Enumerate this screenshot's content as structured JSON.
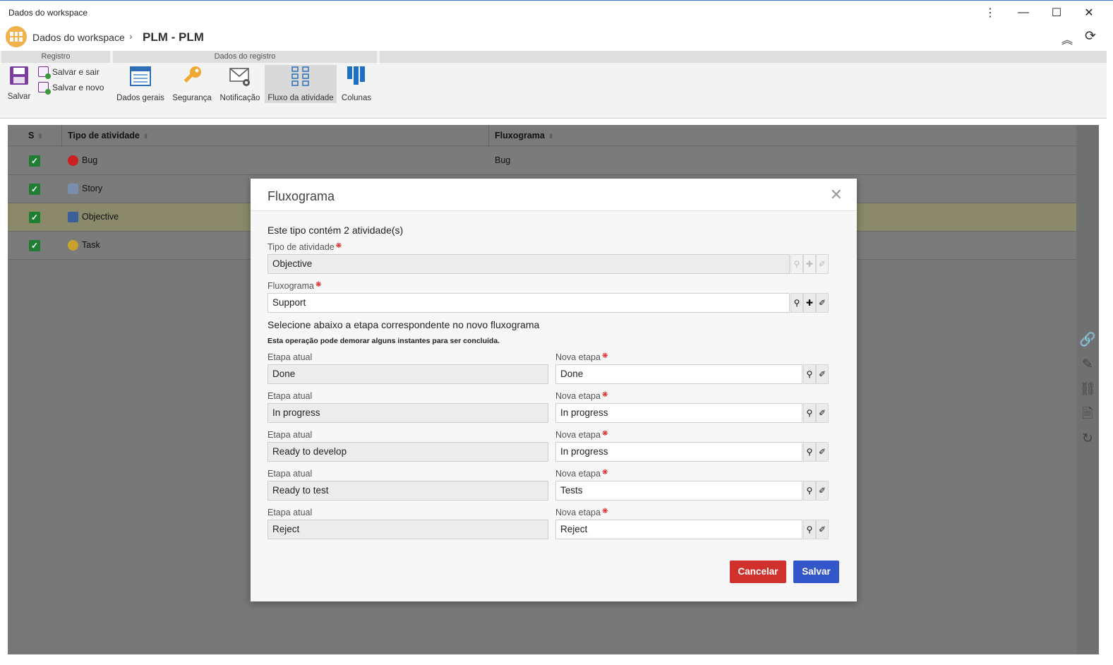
{
  "window": {
    "title": "Dados do workspace"
  },
  "header": {
    "breadcrumb_root": "Dados do workspace",
    "breadcrumb_current": "PLM - PLM"
  },
  "ribbon": {
    "groups": [
      "Registro",
      "Dados do registro"
    ],
    "save": "Salvar",
    "save_exit": "Salvar e sair",
    "save_new": "Salvar e novo",
    "buttons": [
      "Dados gerais",
      "Segurança",
      "Notificação",
      "Fluxo da atividade",
      "Colunas"
    ]
  },
  "grid": {
    "headers": [
      "S",
      "Tipo de atividade",
      "Fluxograma"
    ],
    "rows": [
      {
        "type": "Bug",
        "flow": "Bug",
        "icon": "bug-icon",
        "color": "#cc1f1f"
      },
      {
        "type": "Story",
        "flow": "",
        "icon": "story-icon",
        "color": "#7a8fb0"
      },
      {
        "type": "Objective",
        "flow": "",
        "icon": "objective-icon",
        "color": "#3a5f9a"
      },
      {
        "type": "Task",
        "flow": "",
        "icon": "task-icon",
        "color": "#c9a12a"
      }
    ]
  },
  "modal": {
    "title": "Fluxograma",
    "info": "Este tipo contém 2 atividade(s)",
    "activity_type_label": "Tipo de atividade",
    "activity_type_value": "Objective",
    "flowchart_label": "Fluxograma",
    "flowchart_value": "Support",
    "select_text": "Selecione abaixo a etapa correspondente no novo fluxograma",
    "warning": "Esta operação pode demorar alguns instantes para ser concluída.",
    "current_label": "Etapa atual",
    "new_label": "Nova etapa",
    "steps": [
      {
        "current": "Done",
        "new": "Done"
      },
      {
        "current": "In progress",
        "new": "In progress"
      },
      {
        "current": "Ready to develop",
        "new": "In progress"
      },
      {
        "current": "Ready to test",
        "new": "Tests"
      },
      {
        "current": "Reject",
        "new": "Reject"
      }
    ],
    "cancel": "Cancelar",
    "save": "Salvar"
  },
  "colors": {
    "cancel": "#d0312d",
    "save": "#3357c9",
    "accent": "#1e7e34"
  }
}
